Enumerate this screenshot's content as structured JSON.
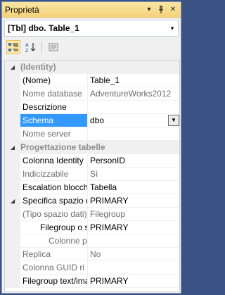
{
  "window": {
    "title": "Proprietà",
    "buttons": {
      "dropdown": "▾",
      "pin": "ᛘ",
      "close": "✕"
    }
  },
  "object_selector": {
    "text": "[Tbl] dbo. Table_1",
    "arrow": "▾"
  },
  "toolbar": {
    "categorized": "categorized-icon",
    "alphabetical": "alphabetical-icon",
    "pages": "property-pages-icon"
  },
  "grid": {
    "identity": {
      "label": "(Identity)",
      "rows": [
        {
          "name": "(Nome)",
          "value": "Table_1"
        },
        {
          "name": "Nome database",
          "value": "AdventureWorks2012"
        },
        {
          "name": "Descrizione",
          "value": ""
        },
        {
          "name": "Schema",
          "value": "dbo"
        },
        {
          "name": "Nome server",
          "value": ""
        }
      ]
    },
    "design": {
      "label": "Progettazione tabelle",
      "rows": [
        {
          "name": "Colonna Identity",
          "value": "PersonID"
        },
        {
          "name": "Indicizzabile",
          "value": "Sì"
        },
        {
          "name": "Escalation blocchi",
          "value": "Tabella"
        },
        {
          "name": "Specifica spazio dati",
          "value": "PRIMARY"
        },
        {
          "name": "(Tipo spazio dati)",
          "value": "Filegroup"
        },
        {
          "name": "Filegroup o schema",
          "value": "PRIMARY"
        },
        {
          "name": "Colonne partizionamento",
          "value": ""
        },
        {
          "name": "Replica",
          "value": "No"
        },
        {
          "name": "Colonna GUID ri",
          "value": ""
        },
        {
          "name": "Filegroup text/image",
          "value": "PRIMARY"
        }
      ]
    }
  }
}
